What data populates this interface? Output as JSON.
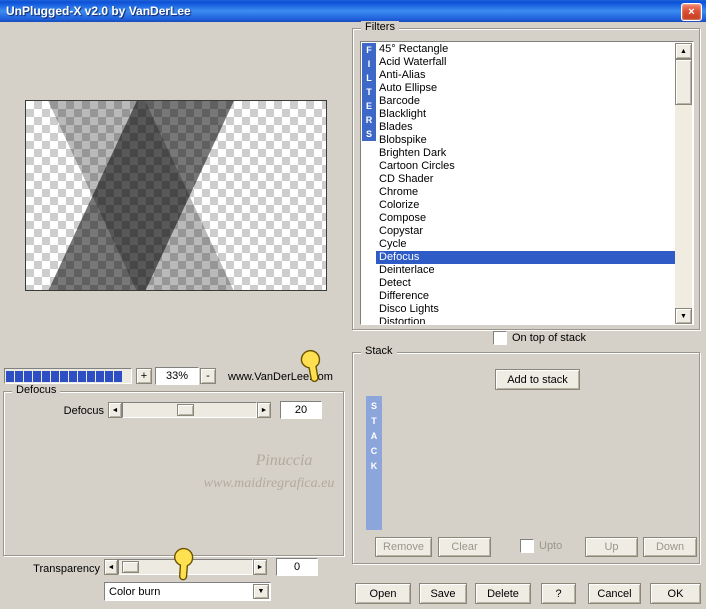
{
  "window": {
    "title": "UnPlugged-X v2.0 by VanDerLee"
  },
  "icons": {
    "close": "×",
    "up": "▲",
    "down": "▼",
    "left": "◄",
    "right": "►"
  },
  "zoom": {
    "segments": 13,
    "plus": "+",
    "value": "33%",
    "minus": "-",
    "site": "www.VanDerLee.com"
  },
  "filters": {
    "label": "Filters",
    "vertical_label": "FILTERS",
    "selected": "Defocus",
    "on_top_label": "On top of stack",
    "items": [
      "45° Rectangle",
      "Acid Waterfall",
      "Anti-Alias",
      "Auto Ellipse",
      "Barcode",
      "Blacklight",
      "Blades",
      "Blobspike",
      "Brighten Dark",
      "Cartoon Circles",
      "CD Shader",
      "Chrome",
      "Colorize",
      "Compose",
      "Copystar",
      "Cycle",
      "Defocus",
      "Deinterlace",
      "Detect",
      "Difference",
      "Disco Lights",
      "Distortion"
    ]
  },
  "defocus": {
    "group_label": "Defocus",
    "param_label": "Defocus",
    "value": "20"
  },
  "watermark": {
    "line1": "Pinuccia",
    "line2": "www.maidiregrafica.eu"
  },
  "transparency": {
    "label": "Transparency",
    "value": "0",
    "blend_mode": "Color burn"
  },
  "stack": {
    "label": "Stack",
    "add_button": "Add to stack",
    "vertical_label": "STACK",
    "remove": "Remove",
    "clear": "Clear",
    "upto_label": "Upto",
    "up": "Up",
    "down": "Down"
  },
  "actions": {
    "open": "Open",
    "save": "Save",
    "delete": "Delete",
    "help": "?",
    "cancel": "Cancel",
    "ok": "OK"
  },
  "colors": {
    "titlebar_blue": "#0B50D8",
    "selection_blue": "#2E5BC6",
    "filters_strip_blue": "#3E68C8",
    "stack_strip_blue": "#8CA6DC",
    "progress_segment_blue": "#2E4FC4",
    "dialog_bg": "#D5D1C8"
  }
}
